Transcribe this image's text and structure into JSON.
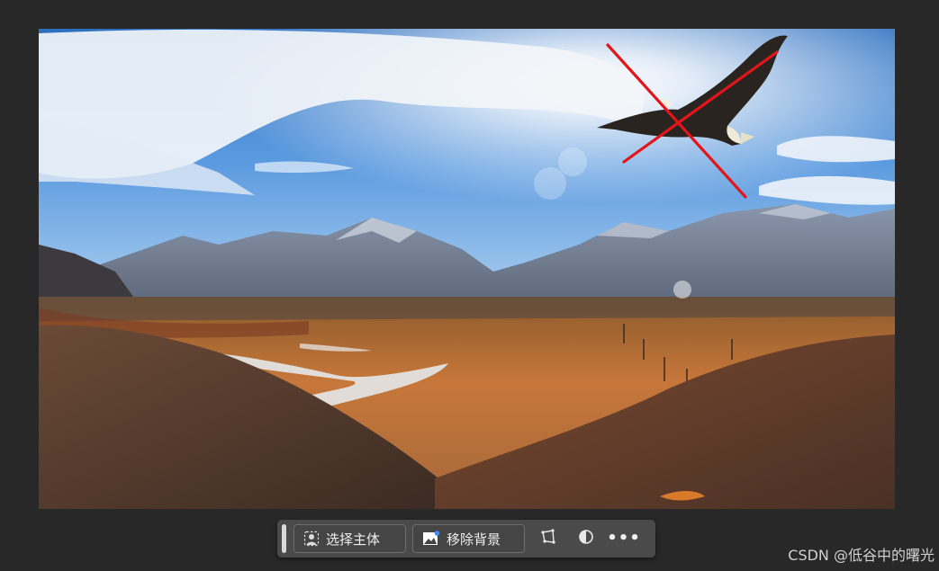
{
  "taskbar": {
    "select_subject_label": "选择主体",
    "remove_background_label": "移除背景",
    "more_label": "•••",
    "icons": [
      "person-select-icon",
      "image-remove-icon",
      "transform-icon",
      "contrast-icon",
      "more-icon"
    ]
  },
  "watermark": "CSDN @低谷中的曙光",
  "colors": {
    "app_background": "#282828",
    "taskbar_background": "#4a4a4a",
    "cross_mark": "#e3151a",
    "accent_dot": "#3b8cff"
  }
}
